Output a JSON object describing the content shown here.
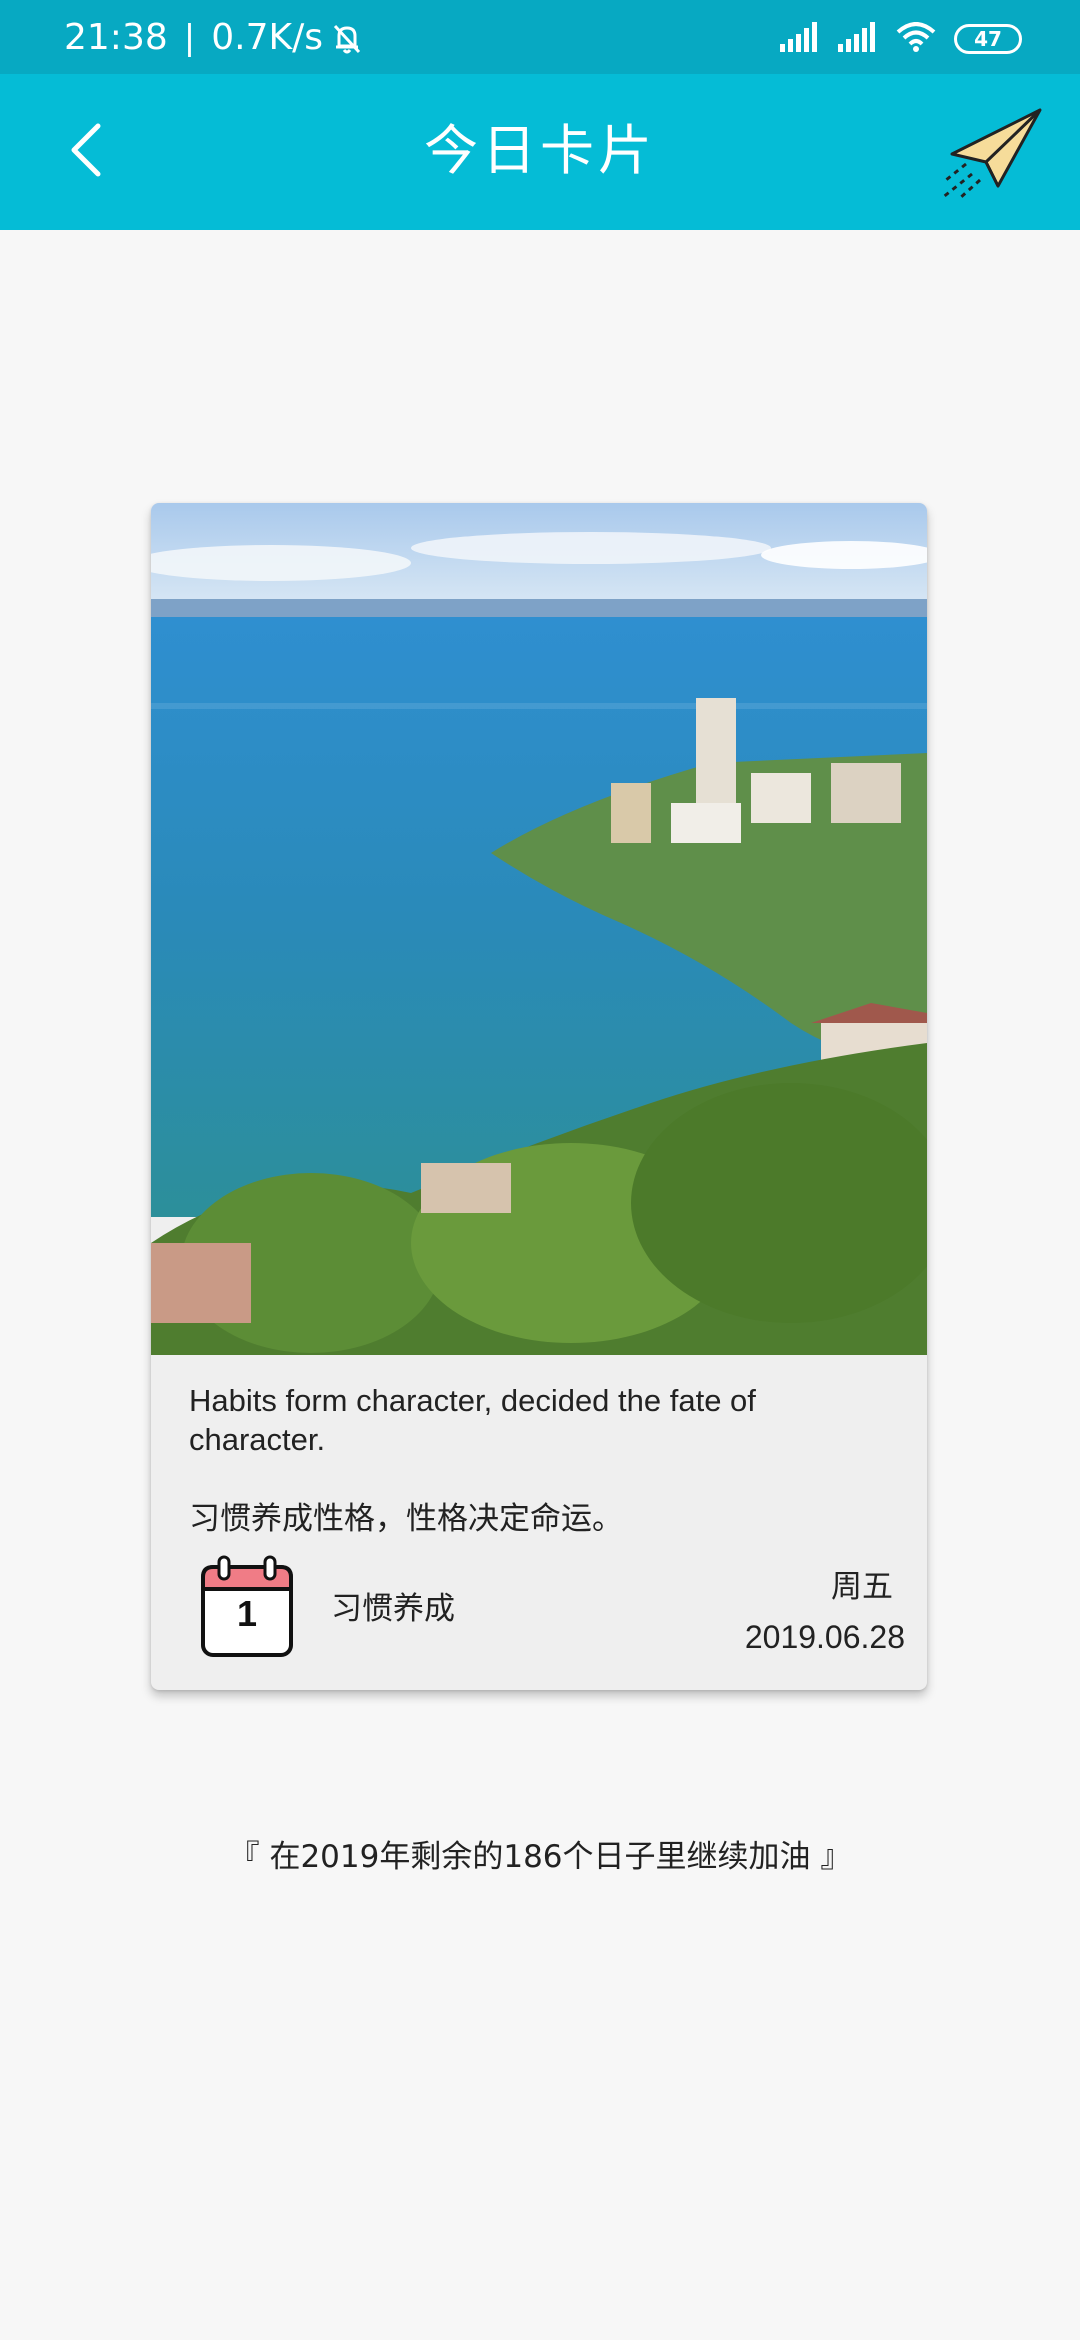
{
  "status_bar": {
    "time": "21:38",
    "separator": "|",
    "net_speed": "0.7K/s",
    "icons": [
      "mute-bell-icon",
      "signal-icon",
      "signal-icon",
      "wifi-icon",
      "battery-icon"
    ],
    "battery_level": "47"
  },
  "app_bar": {
    "back_icon": "chevron-left-icon",
    "title": "今日卡片",
    "share_icon": "paper-plane-icon",
    "color": "#05bcd6"
  },
  "card": {
    "quote_en": "Habits form character, decided the fate of character.",
    "quote_zh": "习惯养成性格，性格决定命运。",
    "calendar_day": "1",
    "habit_name": "习惯养成",
    "weekday": "周五",
    "date": "2019.06.28"
  },
  "footer": {
    "message": "『 在2019年剩余的186个日子里继续加油 』"
  }
}
